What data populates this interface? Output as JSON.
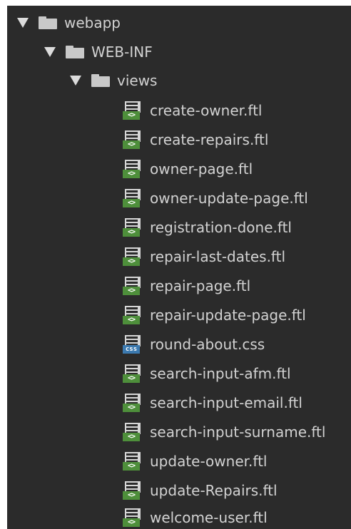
{
  "tree": {
    "folders": [
      {
        "label": "webapp",
        "icon": "folder-icon"
      },
      {
        "label": "WEB-INF",
        "icon": "folder-icon"
      },
      {
        "label": "views",
        "icon": "folder-icon"
      }
    ],
    "files": [
      {
        "label": "create-owner.ftl",
        "type": "ftl",
        "badge": "<>"
      },
      {
        "label": "create-repairs.ftl",
        "type": "ftl",
        "badge": "<>"
      },
      {
        "label": "owner-page.ftl",
        "type": "ftl",
        "badge": "<>"
      },
      {
        "label": "owner-update-page.ftl",
        "type": "ftl",
        "badge": "<>"
      },
      {
        "label": "registration-done.ftl",
        "type": "ftl",
        "badge": "<>"
      },
      {
        "label": "repair-last-dates.ftl",
        "type": "ftl",
        "badge": "<>"
      },
      {
        "label": "repair-page.ftl",
        "type": "ftl",
        "badge": "<>"
      },
      {
        "label": "repair-update-page.ftl",
        "type": "ftl",
        "badge": "<>"
      },
      {
        "label": "round-about.css",
        "type": "css",
        "badge": "css"
      },
      {
        "label": "search-input-afm.ftl",
        "type": "ftl",
        "badge": "<>"
      },
      {
        "label": "search-input-email.ftl",
        "type": "ftl",
        "badge": "<>"
      },
      {
        "label": "search-input-surname.ftl",
        "type": "ftl",
        "badge": "<>"
      },
      {
        "label": "update-owner.ftl",
        "type": "ftl",
        "badge": "<>"
      },
      {
        "label": "update-Repairs.ftl",
        "type": "ftl",
        "badge": "<>"
      },
      {
        "label": "welcome-user.ftl",
        "type": "ftl",
        "badge": "<>"
      }
    ]
  },
  "colors": {
    "background": "#2b2b2b",
    "text": "#d2d2d2",
    "ftl_badge": "#4e8f3b",
    "css_badge": "#3c7ab0"
  }
}
